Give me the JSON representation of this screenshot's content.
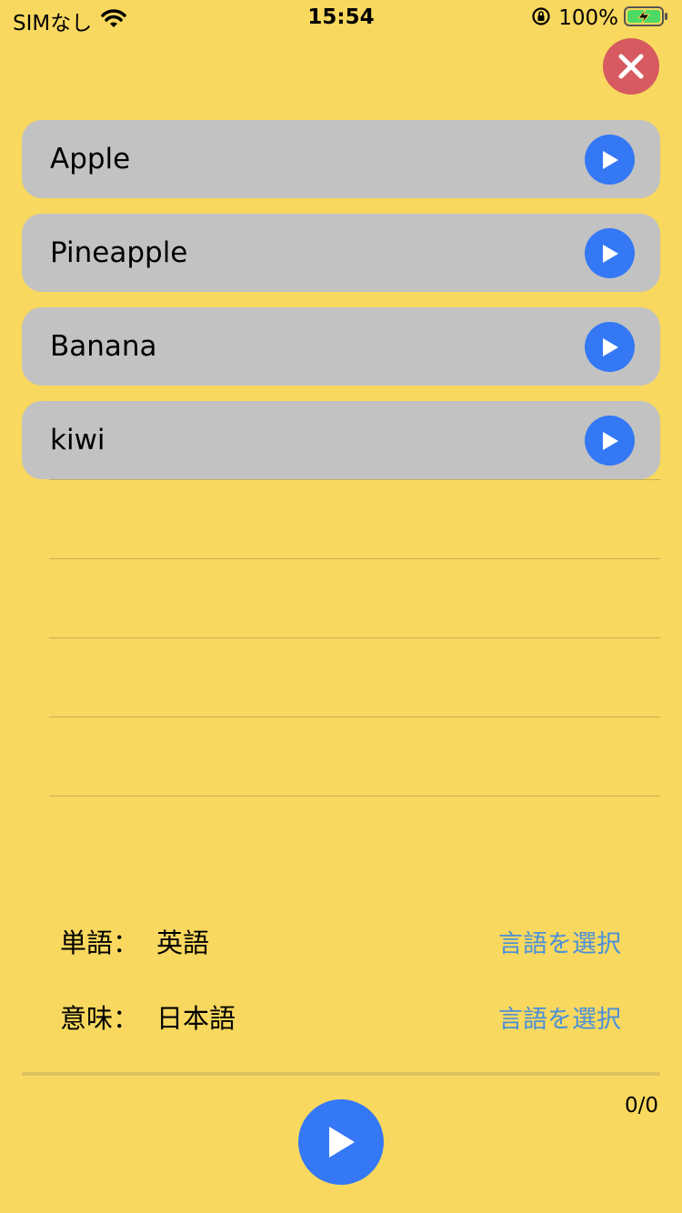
{
  "status_bar": {
    "carrier": "SIMなし",
    "time": "15:54",
    "battery": "100%"
  },
  "words": [
    {
      "label": "Apple"
    },
    {
      "label": "Pineapple"
    },
    {
      "label": "Banana"
    },
    {
      "label": "kiwi"
    }
  ],
  "settings": {
    "word_label": "単語：",
    "word_language": "英語",
    "meaning_label": "意味：",
    "meaning_language": "日本語",
    "select_language": "言語を選択"
  },
  "progress": {
    "counter": "0/0",
    "fraction": 0
  },
  "colors": {
    "background": "#F8D85E",
    "accent": "#3478F6",
    "close": "#D65A60",
    "row": "#C2C2C2",
    "link": "#4A90D9"
  }
}
